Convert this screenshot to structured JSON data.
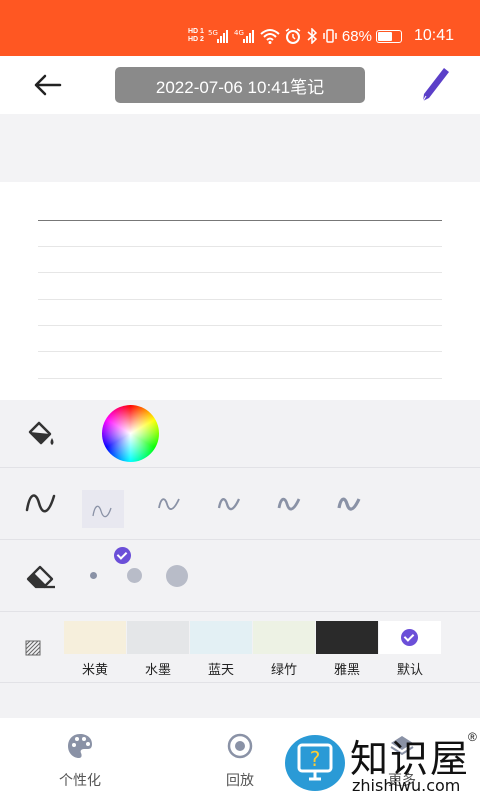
{
  "status_bar": {
    "hd1": "HD 1",
    "hd2": "HD 2",
    "net1": "5G",
    "net2": "4G",
    "battery_percent": "68%",
    "battery_level": 0.68,
    "time": "10:41"
  },
  "top_bar": {
    "title": "2022-07-06 10:41笔记"
  },
  "tools": {
    "pen_styles_selected_index": 0,
    "brush_sizes": [
      "small",
      "medium",
      "large"
    ],
    "backgrounds": [
      {
        "label": "米黄",
        "color": "#f6efdc"
      },
      {
        "label": "水墨",
        "color": "#e4e6e8"
      },
      {
        "label": "蓝天",
        "color": "#e3f0f4"
      },
      {
        "label": "绿竹",
        "color": "#edf2e4"
      },
      {
        "label": "雅黑",
        "color": "#2a2a2a"
      },
      {
        "label": "默认",
        "color": "#ffffff"
      }
    ],
    "selected_background": "默认"
  },
  "bottom_nav": {
    "personalize": "个性化",
    "playback": "回放",
    "more": "更多"
  },
  "watermark": {
    "title": "知识屋",
    "sub": "zhishiwu.com",
    "reg": "®"
  },
  "colors": {
    "status_bar": "#ff5722",
    "accent": "#6b4fd8",
    "title_pill": "#8a8a8a"
  }
}
